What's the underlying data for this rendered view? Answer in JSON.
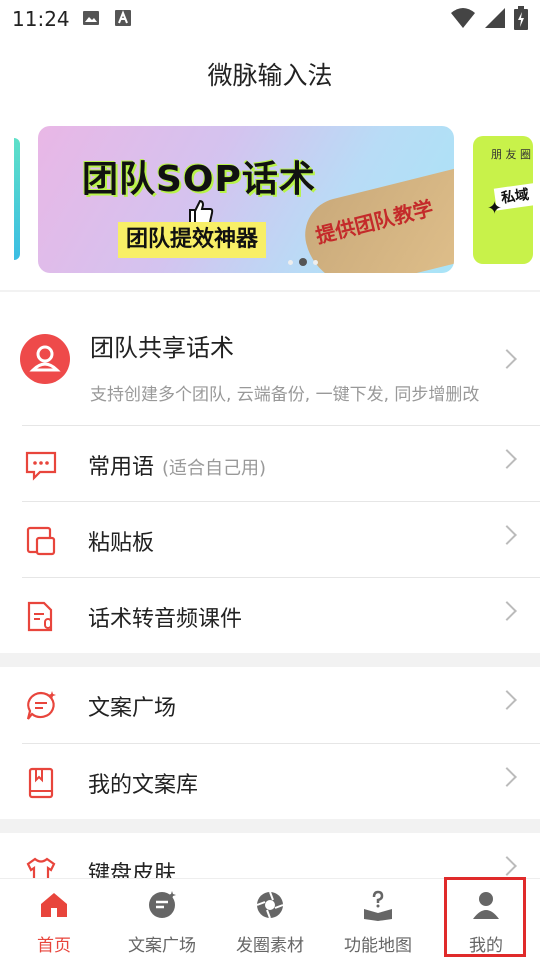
{
  "status": {
    "time": "11:24"
  },
  "app": {
    "title": "微脉输入法"
  },
  "banner": {
    "headline": "团队SOP话术",
    "subtitle": "团队提效神器",
    "tag": "提供团队教学",
    "right_tag": "朋 友 圈",
    "right_note": "私域",
    "active_dot": 2,
    "dot_count": 3
  },
  "share": {
    "title": "团队共享话术",
    "desc": "支持创建多个团队, 云端备份, 一键下发, 同步增删改"
  },
  "group1": [
    {
      "label": "常用语",
      "hint": "(适合自己用)"
    },
    {
      "label": "粘贴板",
      "hint": ""
    },
    {
      "label": "话术转音频课件",
      "hint": ""
    }
  ],
  "group2": [
    {
      "label": "文案广场"
    },
    {
      "label": "我的文案库"
    }
  ],
  "group3": [
    {
      "label": "键盘皮肤"
    }
  ],
  "tabs": [
    {
      "label": "首页",
      "active": true,
      "icon": "home-icon"
    },
    {
      "label": "文案广场",
      "active": false,
      "icon": "chat-square-icon"
    },
    {
      "label": "发圈素材",
      "active": false,
      "icon": "aperture-icon"
    },
    {
      "label": "功能地图",
      "active": false,
      "icon": "help-book-icon"
    },
    {
      "label": "我的",
      "active": false,
      "icon": "person-icon"
    }
  ],
  "colors": {
    "accent": "#e8453c",
    "highlight": "#e02a2a"
  }
}
